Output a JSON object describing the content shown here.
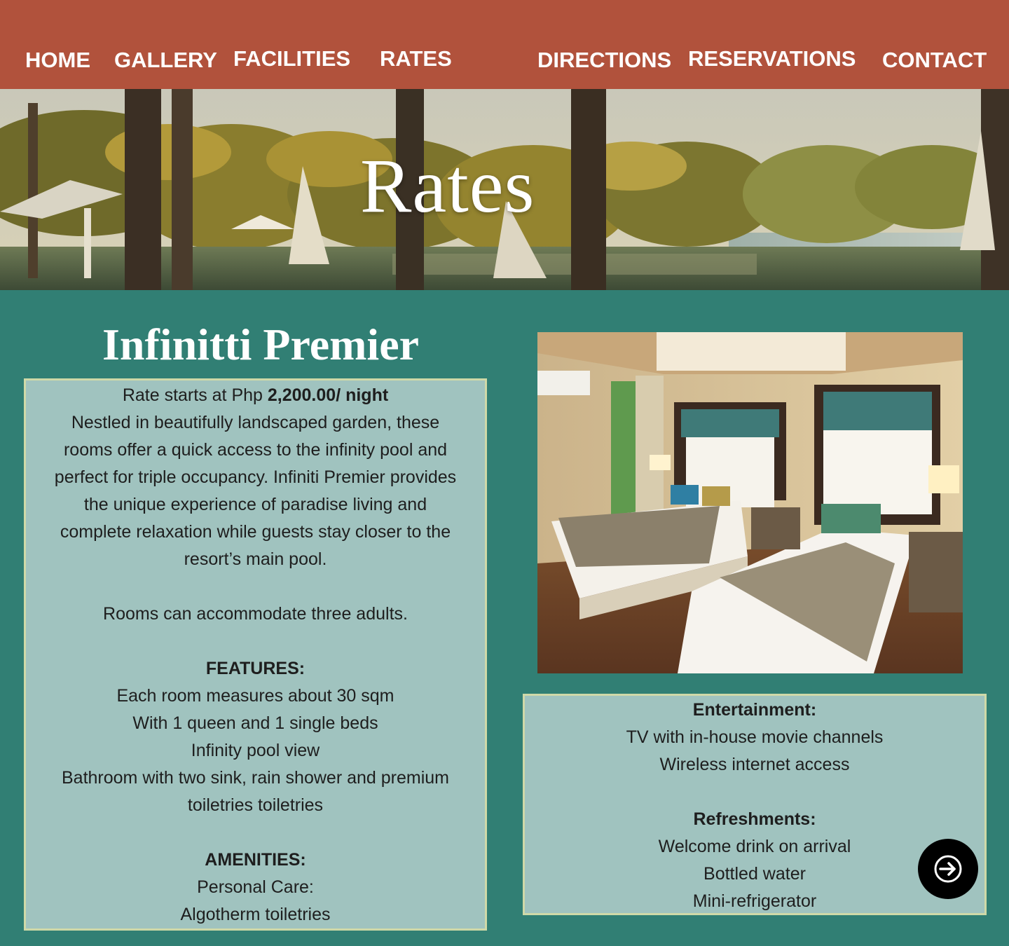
{
  "nav": {
    "items": [
      "HOME",
      "GALLERY",
      "FACILITIES",
      "RATES",
      "DIRECTIONS",
      "RESERVATIONS",
      "CONTACT"
    ]
  },
  "hero": {
    "title": "Rates"
  },
  "room": {
    "title": "Infinitti Premier",
    "rate_prefix": "Rate starts at Php ",
    "rate_value": "2,200.00/ night",
    "description": [
      "Nestled in beautifully landscaped garden, these",
      "rooms offer a quick access to the infinity pool and",
      "perfect for triple occupancy.  Infiniti Premier provides",
      "the unique experience of paradise living and",
      "complete relaxation while guests stay closer to the",
      "resort’s main pool."
    ],
    "capacity": "Rooms can accommodate three adults.",
    "features_heading": "FEATURES:",
    "features": [
      "Each room measures about 30 sqm",
      "With 1 queen and 1 single beds",
      "Infinity pool view",
      "Bathroom with two sink, rain shower and premium",
      "toiletries toiletries"
    ],
    "amenities_heading": "AMENITIES:",
    "amenities": [
      "Personal Care:",
      "Algotherm toiletries"
    ]
  },
  "extras": {
    "entertainment_heading": "Entertainment:",
    "entertainment": [
      "TV with in-house movie channels",
      "Wireless internet access"
    ],
    "refreshments_heading": "Refreshments:",
    "refreshments": [
      "Welcome drink on arrival",
      "Bottled water",
      "Mini-refrigerator"
    ]
  },
  "icons": {
    "next": "arrow-right-icon"
  },
  "colors": {
    "nav_bg": "#b1523c",
    "page_bg": "#317f74",
    "box_bg": "#a0c3bf",
    "box_border": "#cfd9a8"
  }
}
